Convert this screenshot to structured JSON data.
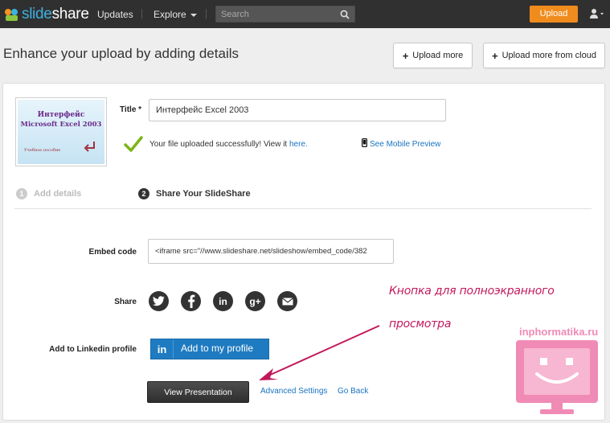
{
  "app": {
    "logo_part1": "slide",
    "logo_part2": "share"
  },
  "nav": {
    "updates": "Updates",
    "explore": "Explore",
    "search_placeholder": "Search",
    "upload": "Upload",
    "accent_color": "#ef8c1d"
  },
  "header": {
    "title": "Enhance your upload by adding details",
    "upload_more": "Upload more",
    "upload_more_cloud": "Upload more from cloud"
  },
  "thumbnail": {
    "line1": "Интерфейс",
    "line2": "Microsoft Excel 2003",
    "line3": "Учебное пособие"
  },
  "form": {
    "title_label": "Title *",
    "title_value": "Интерфейс Excel 2003",
    "upload_status": "Your file uploaded successfully! View it",
    "upload_status_link": "here.",
    "mobile_preview": "See Mobile Preview"
  },
  "steps": [
    {
      "num": "1",
      "label": "Add details",
      "active": false
    },
    {
      "num": "2",
      "label": "Share Your SlideShare",
      "active": true
    }
  ],
  "share": {
    "embed_label": "Embed code",
    "embed_value": "<iframe src=\"//www.slideshare.net/slideshow/embed_code/382",
    "share_label": "Share",
    "icons": [
      "twitter-icon",
      "facebook-icon",
      "linkedin-icon",
      "googleplus-icon",
      "email-icon"
    ],
    "linkedin_label": "Add to Linkedin profile",
    "linkedin_logo": "in",
    "linkedin_button": "Add to my profile"
  },
  "actions": {
    "view_presentation": "View Presentation",
    "advanced_settings": "Advanced Settings",
    "go_back": "Go Back"
  },
  "annotation": {
    "line1": "Кнопка для полноэкранного",
    "line2": "просмотра",
    "color": "#c2185b"
  },
  "watermark": {
    "text": "inphormatika.ru"
  }
}
